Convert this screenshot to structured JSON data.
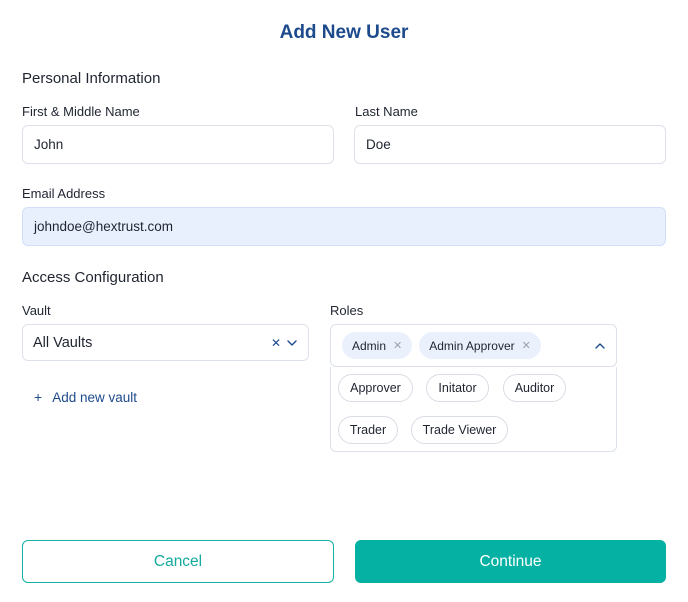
{
  "dialog": {
    "title": "Add New User"
  },
  "personal": {
    "section_title": "Personal Information",
    "first_name": {
      "label": "First & Middle Name",
      "value": "John"
    },
    "last_name": {
      "label": "Last Name",
      "value": "Doe"
    },
    "email": {
      "label": "Email Address",
      "value": "johndoe@hextrust.com"
    }
  },
  "access": {
    "section_title": "Access Configuration",
    "vault": {
      "label": "Vault",
      "value": "All Vaults",
      "add_label": "Add new vault"
    },
    "roles": {
      "label": "Roles",
      "selected": [
        "Admin",
        "Admin Approver"
      ],
      "options": [
        "Approver",
        "Initator",
        "Auditor",
        "Trader",
        "Trade Viewer"
      ]
    }
  },
  "actions": {
    "cancel": "Cancel",
    "continue": "Continue"
  },
  "colors": {
    "brand": "#1d4a8c",
    "accent": "#05b1a3",
    "chip_bg": "#eaf1fd",
    "filled_bg": "#e8f0fe"
  },
  "icons": [
    "clear-icon",
    "chevron-down-icon",
    "chevron-up-icon",
    "remove-chip-icon",
    "plus-icon"
  ]
}
